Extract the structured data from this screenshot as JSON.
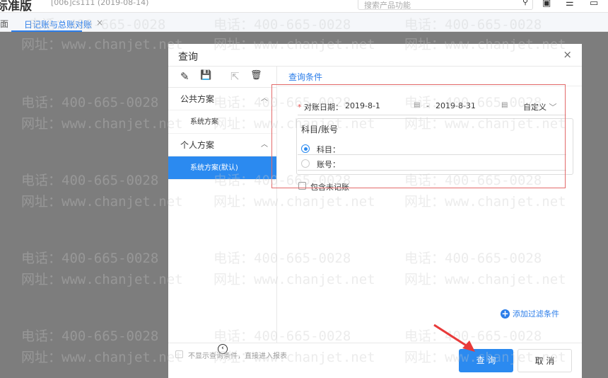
{
  "header": {
    "brand": "标准版",
    "account": "[006]cs111  (2019-08-14)",
    "search_placeholder": "搜索产品功能"
  },
  "tabs": {
    "home": "面",
    "active": "日记账与总账对账",
    "close": "×"
  },
  "watermark": {
    "phone": "电话：400-665-0028",
    "site": "网址：www.chanjet.net"
  },
  "dialog": {
    "title": "查询",
    "close": "×",
    "toolbar": {
      "edit": "✎",
      "save": "💾",
      "export": "⇱",
      "delete": "🗑"
    },
    "groups": [
      {
        "label": "公共方案",
        "items": [
          "系统方案"
        ]
      },
      {
        "label": "个人方案",
        "items": [
          "系统方案(默认)"
        ]
      }
    ],
    "condition_tab": "查询条件",
    "date_label": "对账日期：",
    "date_from": "2019-8-1",
    "date_sep": "-",
    "date_to": "2019-8-31",
    "period": "自定义",
    "subject_group": "科目/账号",
    "subject": "科目：",
    "account": "账号：",
    "include_unposted": "包含未记账",
    "add_filter": "添加过滤条件",
    "skip_hint": "不显示查询条件，直接进入报表",
    "query_button": "查 询",
    "cancel_button": "取 消"
  },
  "colors": {
    "accent": "#2b8af0",
    "highlight": "#e36a6a"
  }
}
